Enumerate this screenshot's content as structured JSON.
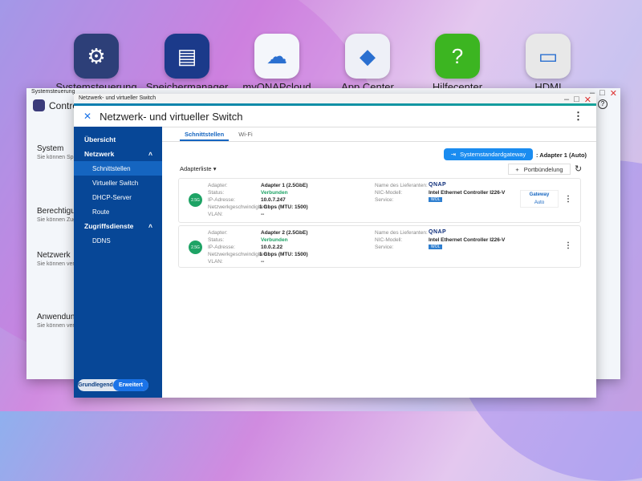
{
  "desktop": {
    "icons": [
      {
        "label": "Systemsteuerung",
        "glyph": "⚙",
        "color": "#2d3f78"
      },
      {
        "label": "Speichermanager",
        "glyph": "▤",
        "color": "#1b3a8a"
      },
      {
        "label": "myQNAPcloud",
        "glyph": "☁",
        "color": "#f4f6fb"
      },
      {
        "label": "App Center",
        "glyph": "◆",
        "color": "#eef0f7"
      },
      {
        "label": "Hilfecenter",
        "glyph": "?",
        "color": "#3cb521"
      },
      {
        "label": "HDMI",
        "glyph": "▭",
        "color": "#e8e8e8"
      }
    ]
  },
  "back_window": {
    "title": "Systemsteuerung",
    "header": "Control Panel",
    "sections": [
      {
        "title": "System",
        "text": "Sie können Spracheinst und extern Benachrich die NAS-Fi NAS auf di Standardei"
      },
      {
        "title": "Berechtigungen",
        "text": "Sie können Zugangsre Nutzer ver Datenträge"
      },
      {
        "title": "Netzwerk",
        "text": "Sie können verwalten, gemeinsam konfigurier Papierkorb NFS und W Netzwerkd"
      },
      {
        "title": "Anwendungen",
        "text": "Sie können verwenden Indizierung Medien für einzurichte"
      }
    ]
  },
  "window": {
    "title_bar": "Netzwerk- und virtueller Switch",
    "title": "Netzwerk- und virtueller Switch"
  },
  "sidebar": {
    "overview": "Übersicht",
    "network": "Netzwerk",
    "items": [
      "Schnittstellen",
      "Virtueller Switch",
      "DHCP-Server",
      "Route"
    ],
    "access": "Zugriffsdienste",
    "access_items": [
      "DDNS"
    ],
    "mode_basic": "Grundlegend",
    "mode_advanced": "Erweitert"
  },
  "tabs": [
    "Schnittstellen",
    "Wi-Fi"
  ],
  "toolbar": {
    "gateway_button": "Systemstandardgateway",
    "gateway_value": ": Adapter 1 (Auto)",
    "port_bundling": "Portbündelung",
    "adapter_list": "Adapterliste"
  },
  "labels": {
    "adapter": "Adapter:",
    "status": "Status:",
    "ip": "IP-Adresse:",
    "speed": "Netzwerkgeschwindigkeit:",
    "vlan": "VLAN:",
    "vendor": "Name des Lieferanten:",
    "nic": "NIC-Modell:",
    "service": "Service:"
  },
  "adapters": [
    {
      "icon": "2.5G",
      "name": "Adapter 1 (2.5GbE)",
      "status": "Verbunden",
      "ip": "10.0.7.247",
      "speed": "1 Gbps (MTU: 1500)",
      "vlan": "--",
      "vendor": "QNAP",
      "nic": "Intel Ethernet Controller I226-V",
      "service": "WOL",
      "gateway": "Gateway",
      "gateway_mode": "Auto"
    },
    {
      "icon": "2.5G",
      "name": "Adapter 2 (2.5GbE)",
      "status": "Verbunden",
      "ip": "10.0.2.22",
      "speed": "1 Gbps (MTU: 1500)",
      "vlan": "--",
      "vendor": "QNAP",
      "nic": "Intel Ethernet Controller I226-V",
      "service": "WOL"
    }
  ]
}
